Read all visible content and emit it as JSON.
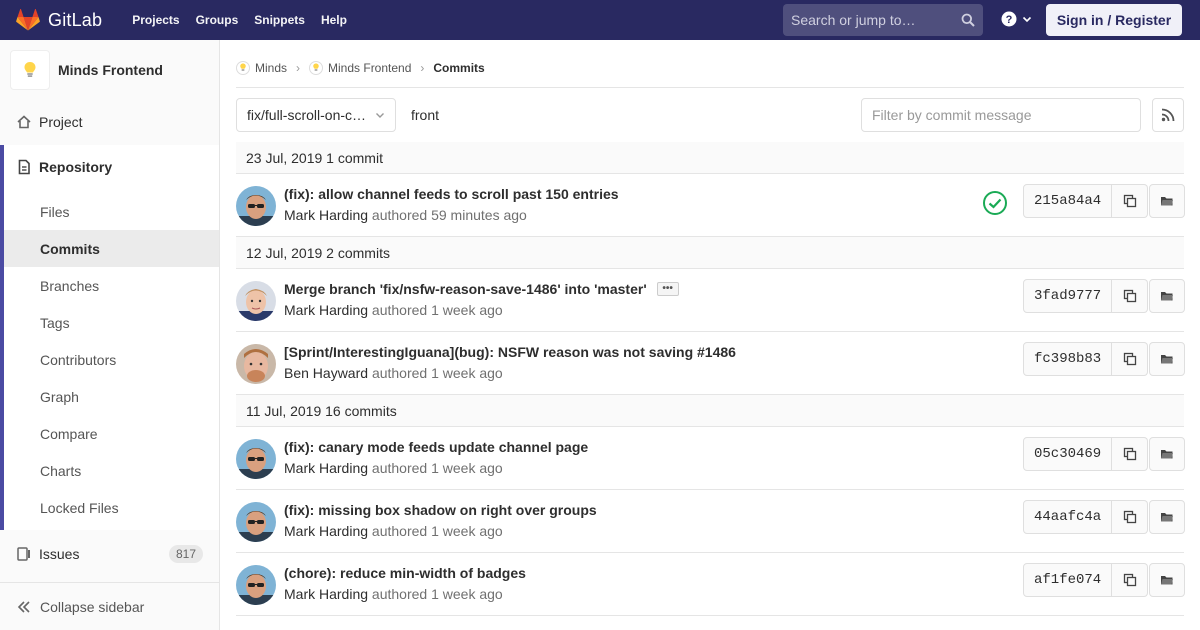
{
  "navbar": {
    "brand": "GitLab",
    "links": [
      "Projects",
      "Groups",
      "Snippets",
      "Help"
    ],
    "search_placeholder": "Search or jump to…",
    "signin_label": "Sign in / Register",
    "bg_color": "#292961"
  },
  "sidebar": {
    "project_name": "Minds Frontend",
    "project_item": "Project",
    "repository_item": "Repository",
    "repository_subitems": [
      "Files",
      "Commits",
      "Branches",
      "Tags",
      "Contributors",
      "Graph",
      "Compare",
      "Charts",
      "Locked Files"
    ],
    "current_subitem": "Commits",
    "issues_label": "Issues",
    "issues_count": "817",
    "collapse_label": "Collapse sidebar"
  },
  "breadcrumb": {
    "items": [
      "Minds",
      "Minds Frontend",
      "Commits"
    ]
  },
  "controls": {
    "branch": "fix/full-scroll-on-c…",
    "path": "front",
    "filter_placeholder": "Filter by commit message"
  },
  "days": [
    {
      "header": "23 Jul, 2019 1 commit",
      "commits": [
        {
          "title": "(fix): allow channel feeds to scroll past 150 entries",
          "author": "Mark Harding",
          "verb": "authored",
          "time": "59 minutes ago",
          "sha": "215a84a4",
          "status": "passed",
          "avatar": "mark"
        }
      ]
    },
    {
      "header": "12 Jul, 2019 2 commits",
      "commits": [
        {
          "title": "Merge branch 'fix/nsfw-reason-save-1486' into 'master'",
          "author": "Mark Harding",
          "verb": "authored",
          "time": "1 week ago",
          "sha": "3fad9777",
          "status": "",
          "avatar": "mark2",
          "expand": true
        },
        {
          "title": "[Sprint/InterestingIguana](bug): NSFW reason was not saving #1486",
          "author": "Ben Hayward",
          "verb": "authored",
          "time": "1 week ago",
          "sha": "fc398b83",
          "status": "",
          "avatar": "ben"
        }
      ]
    },
    {
      "header": "11 Jul, 2019 16 commits",
      "commits": [
        {
          "title": "(fix): canary mode feeds update channel page",
          "author": "Mark Harding",
          "verb": "authored",
          "time": "1 week ago",
          "sha": "05c30469",
          "status": "",
          "avatar": "mark"
        },
        {
          "title": "(fix): missing box shadow on right over groups",
          "author": "Mark Harding",
          "verb": "authored",
          "time": "1 week ago",
          "sha": "44aafc4a",
          "status": "",
          "avatar": "mark"
        },
        {
          "title": "(chore): reduce min-width of badges",
          "author": "Mark Harding",
          "verb": "authored",
          "time": "1 week ago",
          "sha": "af1fe074",
          "status": "",
          "avatar": "mark"
        }
      ]
    }
  ]
}
